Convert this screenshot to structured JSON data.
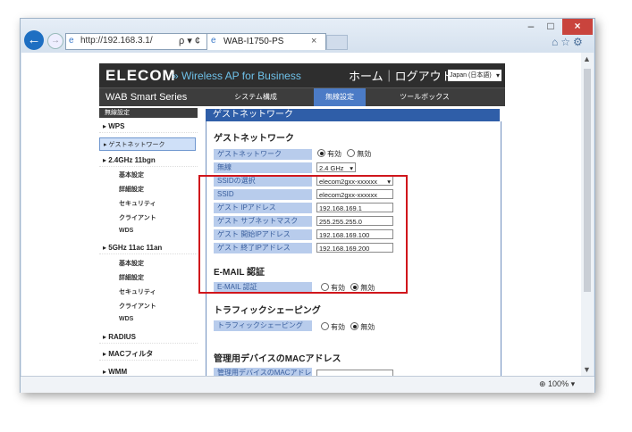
{
  "browser": {
    "url": "http://192.168.3.1/",
    "tab_title": "WAB-I1750-PS",
    "tab_close": "×",
    "window_buttons": [
      "–",
      "□",
      "×"
    ],
    "zoom": "100%",
    "addr_icons": "ρ ▾ ¢"
  },
  "header": {
    "logo": "ELECOM",
    "tagline": "» Wireless AP for Business",
    "nav": "ホーム｜ログアウト",
    "language": "Japan (日本語)",
    "series": "WAB Smart Series",
    "menu": [
      "システム構成",
      "無線設定",
      "ツールボックス"
    ]
  },
  "sidebar": {
    "title": "無線設定",
    "items": [
      {
        "label": "WPS",
        "type": "item"
      },
      {
        "label": "ゲストネットワーク",
        "type": "active"
      },
      {
        "label": "2.4GHz 11bgn",
        "type": "item"
      },
      {
        "label": "基本設定",
        "type": "sub"
      },
      {
        "label": "詳細設定",
        "type": "sub"
      },
      {
        "label": "セキュリティ",
        "type": "sub"
      },
      {
        "label": "クライアント",
        "type": "sub"
      },
      {
        "label": "WDS",
        "type": "sub"
      },
      {
        "label": "5GHz 11ac 11an",
        "type": "item"
      },
      {
        "label": "基本設定",
        "type": "sub"
      },
      {
        "label": "詳細設定",
        "type": "sub"
      },
      {
        "label": "セキュリティ",
        "type": "sub"
      },
      {
        "label": "クライアント",
        "type": "sub"
      },
      {
        "label": "WDS",
        "type": "sub"
      },
      {
        "label": "RADIUS",
        "type": "item"
      },
      {
        "label": "MACフィルタ",
        "type": "item"
      },
      {
        "label": "WMM",
        "type": "item"
      }
    ]
  },
  "main": {
    "panel_title": "ゲストネットワーク",
    "section_title": "ゲストネットワーク",
    "guest_network": {
      "label": "ゲストネットワーク",
      "on": "有効",
      "off": "無効"
    },
    "fields": [
      {
        "label": "無線",
        "value": "2.4 GHz",
        "kind": "select"
      },
      {
        "label": "SSIDの選択",
        "value": "elecom2gxx-xxxxxx",
        "kind": "select"
      },
      {
        "label": "SSID",
        "value": "elecom2gxx-xxxxxx",
        "kind": "input"
      },
      {
        "label": "ゲスト IPアドレス",
        "value": "192.168.169.1",
        "kind": "input"
      },
      {
        "label": "ゲスト サブネットマスク",
        "value": "255.255.255.0",
        "kind": "input"
      },
      {
        "label": "ゲスト 開始IPアドレス",
        "value": "192.168.169.100",
        "kind": "input"
      },
      {
        "label": "ゲスト 終了IPアドレス",
        "value": "192.168.169.200",
        "kind": "input"
      }
    ],
    "email_title": "E-MAIL 認証",
    "email": {
      "label": "E-MAIL 認証",
      "on": "有効",
      "off": "無効"
    },
    "traffic_title": "トラフィックシェーピング",
    "traffic": {
      "label": "トラフィックシェーピング",
      "on": "有効",
      "off": "無効"
    },
    "mac_title": "管理用デバイスのMACアドレス",
    "mac_label": "管理用デバイスのMACアドレ"
  },
  "colors": {
    "highlight": "#d0161c",
    "accent": "#2f5ea8"
  }
}
